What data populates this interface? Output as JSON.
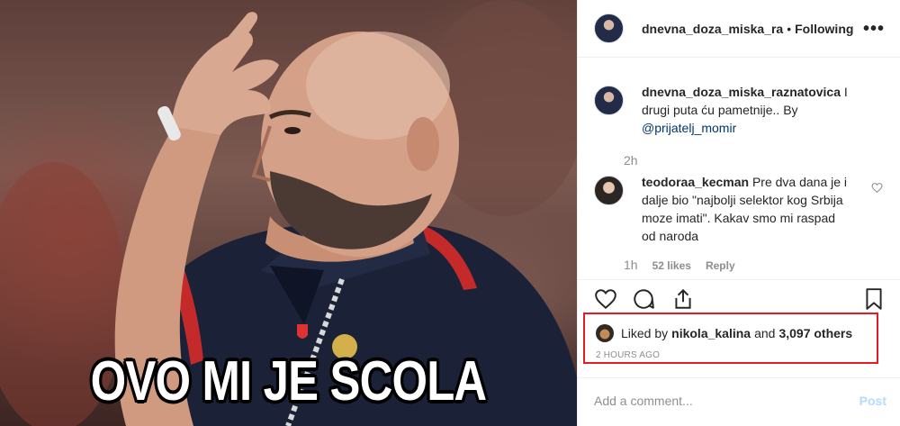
{
  "post": {
    "meme_caption": "OVO MI JE SCOLA"
  },
  "header": {
    "username": "dnevna_doza_miska_ra",
    "separator": "•",
    "follow_status": "Following",
    "more_icon": "more-horizontal-icon"
  },
  "caption": {
    "username": "dnevna_doza_miska_raznatovica",
    "text": " I drugi puta ću pametnije.. By ",
    "mention": "@prijatelj_momir",
    "time": "2h"
  },
  "comments": [
    {
      "username": "teodoraa_kecman",
      "text": " Pre dva dana je i dalje bio \"najbolji selektor kog Srbija moze imati\". Kakav smo mi raspad od naroda",
      "time": "1h",
      "likes": "52 likes",
      "reply_label": "Reply"
    }
  ],
  "actions": {
    "like_icon": "heart-icon",
    "comment_icon": "comment-icon",
    "share_icon": "share-icon",
    "save_icon": "bookmark-icon"
  },
  "likes": {
    "prefix": "Liked by",
    "user": "nikola_kalina",
    "conjunction": "and",
    "others": "3,097 others"
  },
  "post_time": "2 HOURS AGO",
  "add_comment": {
    "placeholder": "Add a comment...",
    "post_label": "Post"
  },
  "colors": {
    "highlight_border": "#e21b24",
    "mention": "#00376b",
    "post_button_disabled": "#b3dbff"
  }
}
